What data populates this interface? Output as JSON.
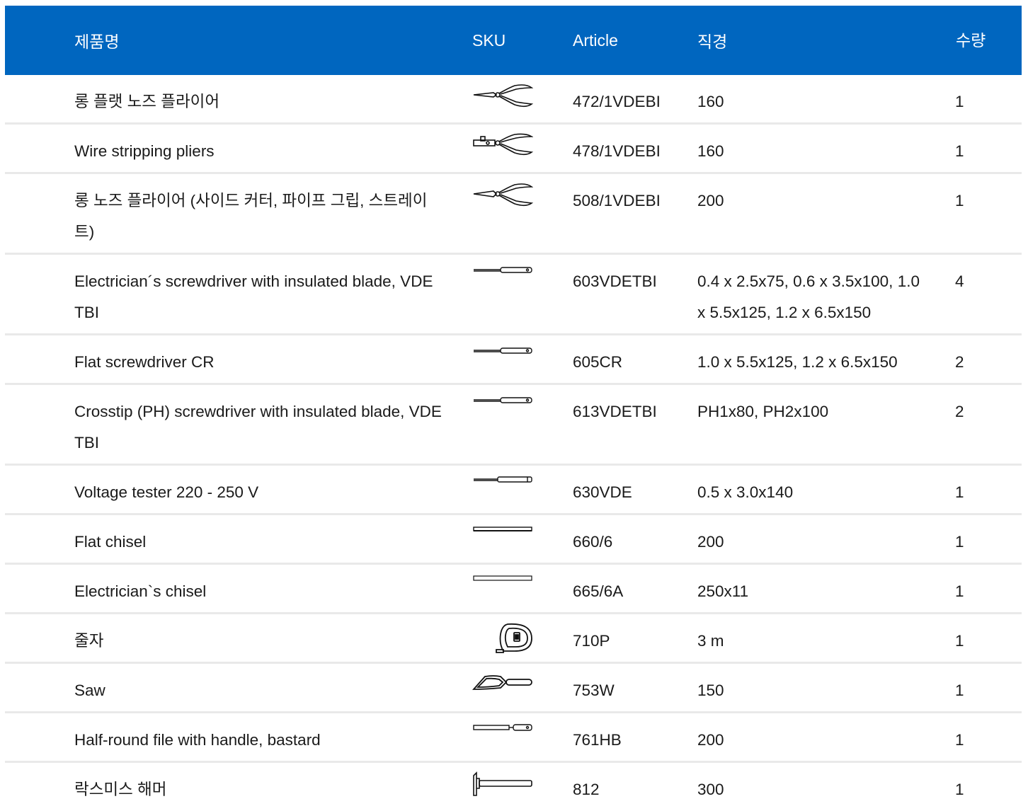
{
  "header": {
    "name": "제품명",
    "sku": "SKU",
    "article": "Article",
    "diameter": "직경",
    "qty_line1": "수",
    "qty_line2": "량"
  },
  "rows": [
    {
      "name": "롱 플랫 노즈 플라이어",
      "icon": "long-flat-nose-pliers-icon",
      "article": "472/1VDEBI",
      "diameter": "160",
      "qty": "1"
    },
    {
      "name": "Wire stripping pliers",
      "icon": "wire-stripping-pliers-icon",
      "article": "478/1VDEBI",
      "diameter": "160",
      "qty": "1"
    },
    {
      "name": "롱 노즈 플라이어 (사이드 커터, 파이프 그립, 스트레이트)",
      "icon": "long-nose-pliers-icon",
      "article": "508/1VDEBI",
      "diameter": "200",
      "qty": "1"
    },
    {
      "name": "Electrician´s screwdriver with insulated blade, VDE TBI",
      "icon": "screwdriver-icon",
      "article": "603VDETBI",
      "diameter": "0.4 x 2.5x75, 0.6 x 3.5x100, 1.0 x 5.5x125, 1.2 x 6.5x150",
      "qty": "4"
    },
    {
      "name": "Flat screwdriver CR",
      "icon": "flat-screwdriver-icon",
      "article": "605CR",
      "diameter": "1.0 x 5.5x125, 1.2 x 6.5x150",
      "qty": "2"
    },
    {
      "name": "Crosstip (PH) screwdriver with insulated blade, VDE TBI",
      "icon": "crosstip-screwdriver-icon",
      "article": "613VDETBI",
      "diameter": "PH1x80, PH2x100",
      "qty": "2"
    },
    {
      "name": "Voltage tester 220 - 250 V",
      "icon": "voltage-tester-icon",
      "article": "630VDE",
      "diameter": "0.5 x 3.0x140",
      "qty": "1"
    },
    {
      "name": "Flat chisel",
      "icon": "flat-chisel-icon",
      "article": "660/6",
      "diameter": "200",
      "qty": "1"
    },
    {
      "name": "Electrician`s chisel",
      "icon": "electricians-chisel-icon",
      "article": "665/6A",
      "diameter": "250x11",
      "qty": "1"
    },
    {
      "name": "줄자",
      "icon": "tape-measure-icon",
      "article": "710P",
      "diameter": "3 m",
      "qty": "1"
    },
    {
      "name": "Saw",
      "icon": "saw-icon",
      "article": "753W",
      "diameter": "150",
      "qty": "1"
    },
    {
      "name": "Half-round file with handle, bastard",
      "icon": "half-round-file-icon",
      "article": "761HB",
      "diameter": "200",
      "qty": "1"
    },
    {
      "name": "락스미스 해머",
      "icon": "hammer-icon",
      "article": "812",
      "diameter": "300",
      "qty": "1"
    }
  ]
}
